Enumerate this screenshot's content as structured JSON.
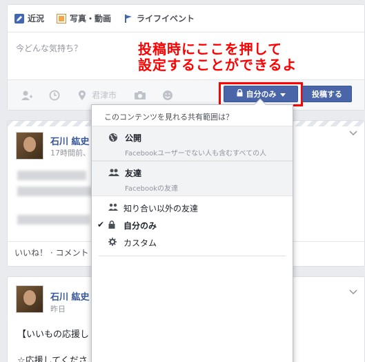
{
  "composer": {
    "tabs": [
      {
        "label": "近況",
        "icon": "pencil-icon"
      },
      {
        "label": "写真・動画",
        "icon": "photo-icon"
      },
      {
        "label": "ライフイベント",
        "icon": "flag-icon"
      }
    ],
    "placeholder": "今どんな気持ち？",
    "location_text": "君津市",
    "privacy_label": "自分のみ",
    "post_label": "投稿する"
  },
  "annotation": {
    "line1": "投稿時にここを押して",
    "line2": "設定することができるよ"
  },
  "dropdown": {
    "header": "このコンテンツを見れる共有範囲は？",
    "big_items": [
      {
        "title": "公開",
        "subtitle": "Facebookユーザーでない人も含むすべての人",
        "icon": "globe-icon"
      },
      {
        "title": "友達",
        "subtitle": "Facebookの友達",
        "icon": "friends-icon"
      }
    ],
    "items": [
      {
        "label": "知り合い以外の友達",
        "icon": "friends-icon",
        "checked": false
      },
      {
        "label": "自分のみ",
        "icon": "lock-icon",
        "checked": true
      },
      {
        "label": "カスタム",
        "icon": "gear-icon",
        "checked": false
      }
    ],
    "check_mark": "✔"
  },
  "posts": [
    {
      "name": "石川 紘史",
      "time": "17時間前、",
      "actions": "いいね！ · コメント"
    },
    {
      "name": "石川 紘史",
      "time": "昨日",
      "text1": "【いいもの応援し",
      "text2": "☆応援してくださ"
    }
  ]
}
